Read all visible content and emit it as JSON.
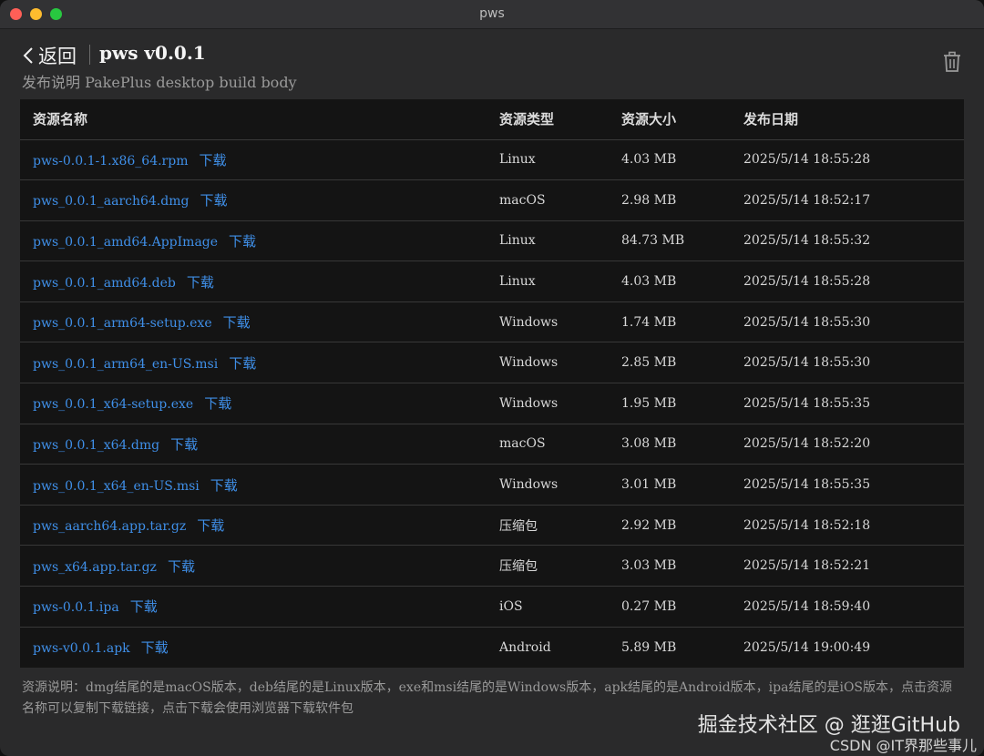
{
  "window": {
    "title": "pws"
  },
  "header": {
    "back_label": "返回",
    "title": "pws v0.0.1",
    "subtitle": "发布说明 PakePlus desktop build body"
  },
  "table": {
    "columns": [
      "资源名称",
      "资源类型",
      "资源大小",
      "发布日期"
    ],
    "download_label": "下载",
    "rows": [
      {
        "name": "pws-0.0.1-1.x86_64.rpm",
        "type": "Linux",
        "size": "4.03 MB",
        "date": "2025/5/14 18:55:28"
      },
      {
        "name": "pws_0.0.1_aarch64.dmg",
        "type": "macOS",
        "size": "2.98 MB",
        "date": "2025/5/14 18:52:17"
      },
      {
        "name": "pws_0.0.1_amd64.AppImage",
        "type": "Linux",
        "size": "84.73 MB",
        "date": "2025/5/14 18:55:32"
      },
      {
        "name": "pws_0.0.1_amd64.deb",
        "type": "Linux",
        "size": "4.03 MB",
        "date": "2025/5/14 18:55:28"
      },
      {
        "name": "pws_0.0.1_arm64-setup.exe",
        "type": "Windows",
        "size": "1.74 MB",
        "date": "2025/5/14 18:55:30"
      },
      {
        "name": "pws_0.0.1_arm64_en-US.msi",
        "type": "Windows",
        "size": "2.85 MB",
        "date": "2025/5/14 18:55:30"
      },
      {
        "name": "pws_0.0.1_x64-setup.exe",
        "type": "Windows",
        "size": "1.95 MB",
        "date": "2025/5/14 18:55:35"
      },
      {
        "name": "pws_0.0.1_x64.dmg",
        "type": "macOS",
        "size": "3.08 MB",
        "date": "2025/5/14 18:52:20"
      },
      {
        "name": "pws_0.0.1_x64_en-US.msi",
        "type": "Windows",
        "size": "3.01 MB",
        "date": "2025/5/14 18:55:35"
      },
      {
        "name": "pws_aarch64.app.tar.gz",
        "type": "压缩包",
        "size": "2.92 MB",
        "date": "2025/5/14 18:52:18"
      },
      {
        "name": "pws_x64.app.tar.gz",
        "type": "压缩包",
        "size": "3.03 MB",
        "date": "2025/5/14 18:52:21"
      },
      {
        "name": "pws-0.0.1.ipa",
        "type": "iOS",
        "size": "0.27 MB",
        "date": "2025/5/14 18:59:40"
      },
      {
        "name": "pws-v0.0.1.apk",
        "type": "Android",
        "size": "5.89 MB",
        "date": "2025/5/14 19:00:49"
      }
    ]
  },
  "footnote": "资源说明：dmg结尾的是macOS版本，deb结尾的是Linux版本，exe和msi结尾的是Windows版本，apk结尾的是Android版本，ipa结尾的是iOS版本，点击资源名称可以复制下载链接，点击下载会使用浏览器下载软件包",
  "watermark": {
    "line1": "掘金技术社区 @ 逛逛GitHub",
    "line2": "CSDN @IT界那些事儿"
  },
  "icons": {
    "back": "chevron-left-icon",
    "delete": "trash-icon"
  },
  "colors": {
    "link": "#3f8fe8",
    "background": "#2a2a2b",
    "table_bg": "#141414"
  }
}
